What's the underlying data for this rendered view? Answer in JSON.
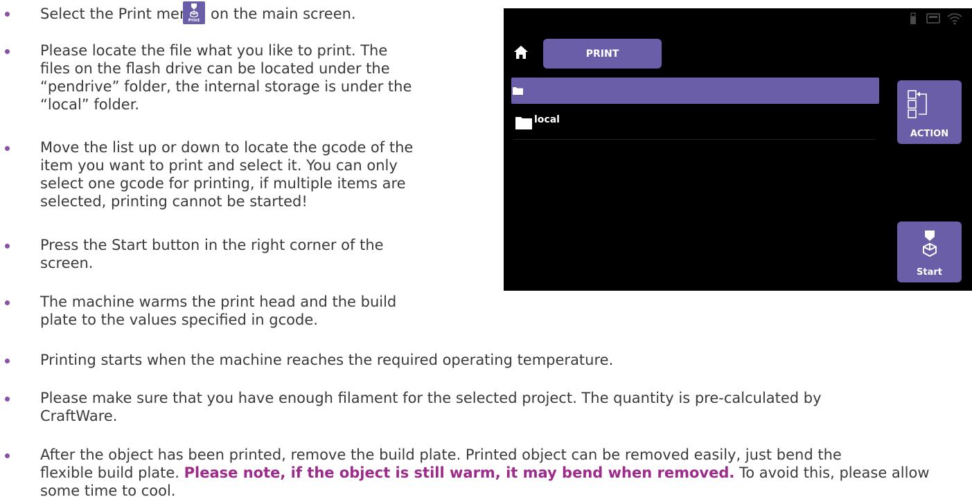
{
  "bullets": [
    {
      "lines": [
        "Select the Print menu",
        "on the main screen."
      ]
    },
    {
      "lines": [
        "Please locate the file what you like to print. The",
        "files on the flash drive can be located under the",
        "“pendrive” folder, the internal storage is under the",
        "“local” folder."
      ]
    },
    {
      "lines": [
        "Move the list up or down to locate the gcode of the",
        "item you want to print and select it. You can only",
        "select one gcode for printing, if multiple items are",
        "selected, printing cannot be started!"
      ]
    },
    {
      "lines": [
        "Press the Start button in the right corner of the",
        "screen."
      ]
    },
    {
      "lines": [
        "The machine warms the print head and the build",
        "plate to the values specified in gcode."
      ]
    },
    {
      "lines": [
        "Printing starts when the machine reaches the required operating temperature."
      ]
    },
    {
      "lines": [
        "Please make sure that you have enough filament for the selected project. The quantity is pre-calculated by",
        "CraftWare."
      ]
    },
    {
      "line1": "After the object has been printed, remove the build plate. Printed object can be removed easily, just bend the",
      "line2_pre": "flexible build plate. ",
      "line2_highlight": "Please note, if the object is still warm, it may bend when removed.",
      "line2_post": " To avoid this, please allow",
      "line3": "some time to cool."
    }
  ],
  "inline_icon": {
    "icon": "print-icon",
    "label": "Print"
  },
  "screen": {
    "title": "PRINT",
    "home_icon": "home-icon",
    "status_icons": [
      "usb-icon",
      "storage-icon",
      "wifi-icon"
    ],
    "files": [
      {
        "name": "",
        "selected": true,
        "icon": "folder-icon"
      },
      {
        "name": "local",
        "selected": false,
        "icon": "folder-icon"
      }
    ],
    "action_label": "ACTION",
    "start_label": "Start"
  },
  "colors": {
    "accent": "#6b5ea8",
    "bullet": "#8a4fa7",
    "highlight": "#9c2b8b",
    "screen_bg": "#000000"
  }
}
